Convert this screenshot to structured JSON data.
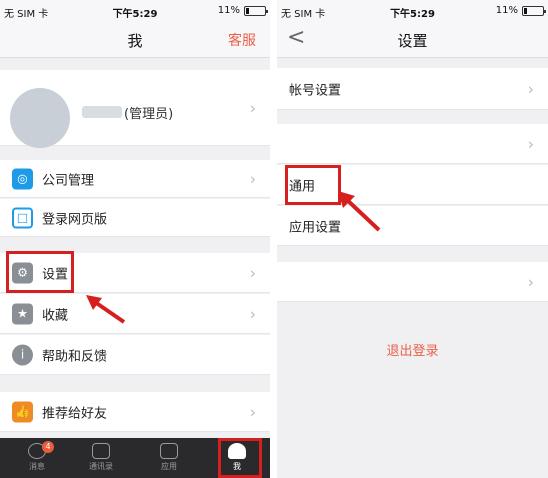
{
  "left": {
    "status": {
      "carrier": "无 SIM 卡",
      "time": "下午5:29",
      "battery": "11%"
    },
    "nav": {
      "title": "我",
      "right": "客服"
    },
    "profile": {
      "role": "(管理员)"
    },
    "menu": {
      "company": "公司管理",
      "web_login": "登录网页版",
      "settings": "设置",
      "favorites": "收藏",
      "help": "帮助和反馈",
      "recommend": "推荐给好友"
    },
    "tabs": [
      {
        "label": "消息",
        "badge": "4"
      },
      {
        "label": "通讯录"
      },
      {
        "label": "应用"
      },
      {
        "label": "我"
      }
    ]
  },
  "right": {
    "status": {
      "carrier": "无 SIM 卡",
      "time": "下午5:29",
      "battery": "11%"
    },
    "nav": {
      "title": "设置",
      "back": "<"
    },
    "items": {
      "account": "帐号设置",
      "general": "通用",
      "app_settings": "应用设置"
    },
    "logout": "退出登录"
  },
  "colors": {
    "accent": "#e9614a",
    "highlight": "#d62020",
    "tabbar": "#2a2a2c"
  }
}
